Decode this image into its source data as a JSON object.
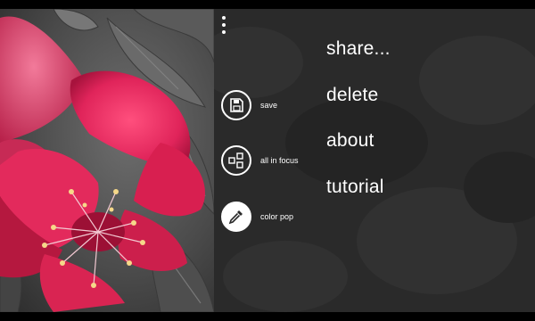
{
  "app_bar": {
    "more_icon": "ellipsis-vertical-icon",
    "buttons": [
      {
        "label": "save",
        "icon": "save-disk-icon"
      },
      {
        "label": "all in focus",
        "icon": "all-in-focus-icon"
      },
      {
        "label": "color pop",
        "icon": "eyedropper-icon"
      }
    ],
    "menu": [
      {
        "label": "share..."
      },
      {
        "label": "delete"
      },
      {
        "label": "about"
      },
      {
        "label": "tutorial"
      }
    ]
  },
  "colors": {
    "flower": "#e0245a",
    "panel": "#2b2b2b",
    "text": "#ffffff"
  }
}
